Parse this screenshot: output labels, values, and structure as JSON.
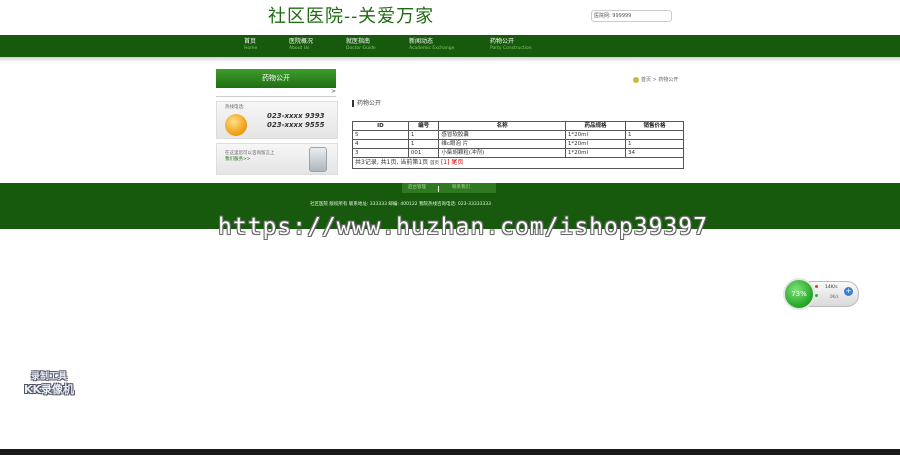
{
  "header": {
    "site_title": "社区医院--关爱万家",
    "search_text": "医院网: 999999"
  },
  "nav": {
    "items": [
      {
        "label": "首页",
        "sub": "Home"
      },
      {
        "label": "医院概况",
        "sub": "About Us"
      },
      {
        "label": "就医指南",
        "sub": "Doctor Guide"
      },
      {
        "label": "新闻动态",
        "sub": "Academic Exchange"
      },
      {
        "label": "药物公开",
        "sub": "Party Construction"
      }
    ]
  },
  "sidebar": {
    "title": "药物公开",
    "arrow": ">",
    "hotline_label": "热线电话:",
    "hotline_numbers": [
      "023-xxxx 9393",
      "023-xxxx 9555"
    ],
    "message_text": "在这里您可以咨询留言上",
    "message_link": "我们服务>>"
  },
  "breadcrumb": {
    "home": "首页",
    "sep": ">",
    "current": "药物公开"
  },
  "content": {
    "title": "药物公开",
    "table": {
      "headers": [
        "ID",
        "编号",
        "名称",
        "药品规格",
        "销售价格"
      ],
      "rows": [
        [
          "5",
          "1",
          "感冒软胶囊",
          "1*20ml",
          "1"
        ],
        [
          "4",
          "1",
          "维c眼泡 片",
          "1*20ml",
          "1"
        ],
        [
          "3",
          "001",
          "小柴胡颗粒(冲剂)",
          "1*20ml",
          "34"
        ]
      ]
    },
    "pager": {
      "summary": "共3记录, 共1页, 当前第1页",
      "first": "首页",
      "current": "[1]",
      "last": "尾页"
    }
  },
  "footer": {
    "tab_left": "后台管理",
    "tab_right": "联系我们",
    "text": "社区医院 版权所有 联系地址: 333333 邮编: 400122 我院热线咨询电话: 023-33333333"
  },
  "watermark": "https://www.huzhan.com/ishop39397",
  "net_widget": {
    "percent": "73%",
    "speed": "14K/s",
    "sub": "0K/s",
    "plus": "+"
  },
  "recorder": {
    "line1": "录制工具",
    "line2": "KK录像机"
  }
}
